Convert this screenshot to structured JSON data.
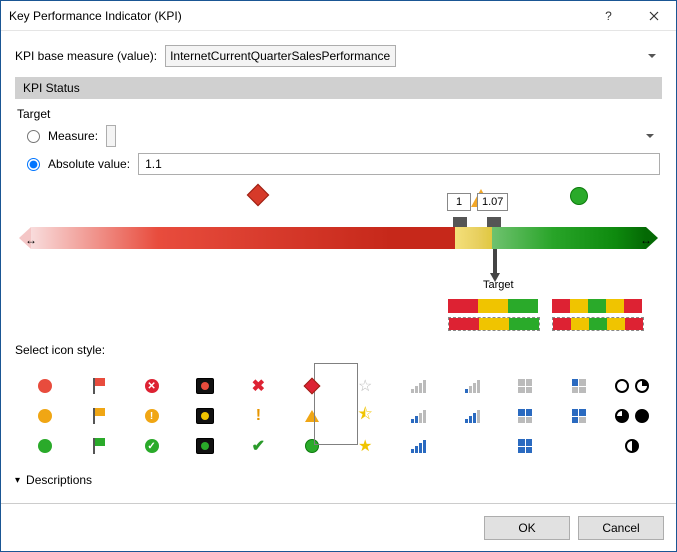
{
  "window": {
    "title": "Key Performance Indicator (KPI)"
  },
  "base": {
    "label": "KPI base measure (value):",
    "value": "InternetCurrentQuarterSalesPerformance"
  },
  "status": {
    "header": "KPI Status",
    "target_label": "Target",
    "measure_label": "Measure:",
    "absolute_label": "Absolute value:",
    "absolute_value": "1.1",
    "target_caption": "Target",
    "thresholds": {
      "low": "1",
      "high": "1.07"
    }
  },
  "select_style": {
    "label": "Select icon style:"
  },
  "expander": {
    "label": "Descriptions"
  },
  "buttons": {
    "ok": "OK",
    "cancel": "Cancel"
  }
}
